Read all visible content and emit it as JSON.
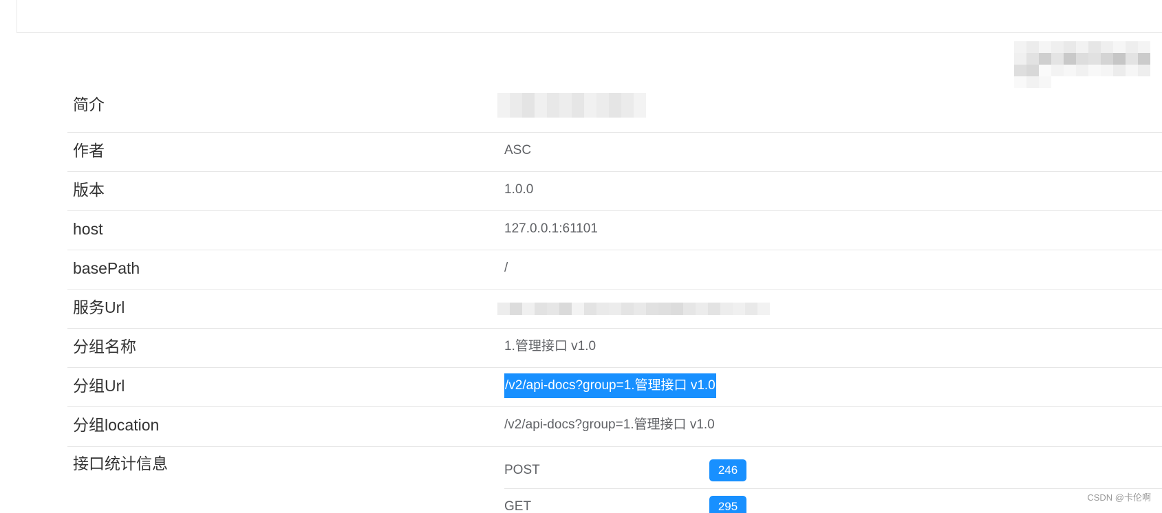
{
  "rows": [
    {
      "key": "简介",
      "value": ""
    },
    {
      "key": "作者",
      "value": "ASC"
    },
    {
      "key": "版本",
      "value": "1.0.0"
    },
    {
      "key": "host",
      "value": "127.0.0.1:61101"
    },
    {
      "key": "basePath",
      "value": "/"
    },
    {
      "key": "服务Url",
      "value": ""
    },
    {
      "key": "分组名称",
      "value": "1.管理接口 v1.0"
    },
    {
      "key": "分组Url",
      "value": "/v2/api-docs?group=1.管理接口 v1.0"
    },
    {
      "key": "分组location",
      "value": "/v2/api-docs?group=1.管理接口 v1.0"
    },
    {
      "key": "接口统计信息",
      "value": ""
    }
  ],
  "stats": [
    {
      "method": "POST",
      "count": "246"
    },
    {
      "method": "GET",
      "count": "295"
    }
  ],
  "watermark": "CSDN @卡伦啊",
  "colors": {
    "accent": "#1890ff",
    "text_key": "#333333",
    "text_value": "#606266",
    "divider": "#e6e6e6"
  }
}
